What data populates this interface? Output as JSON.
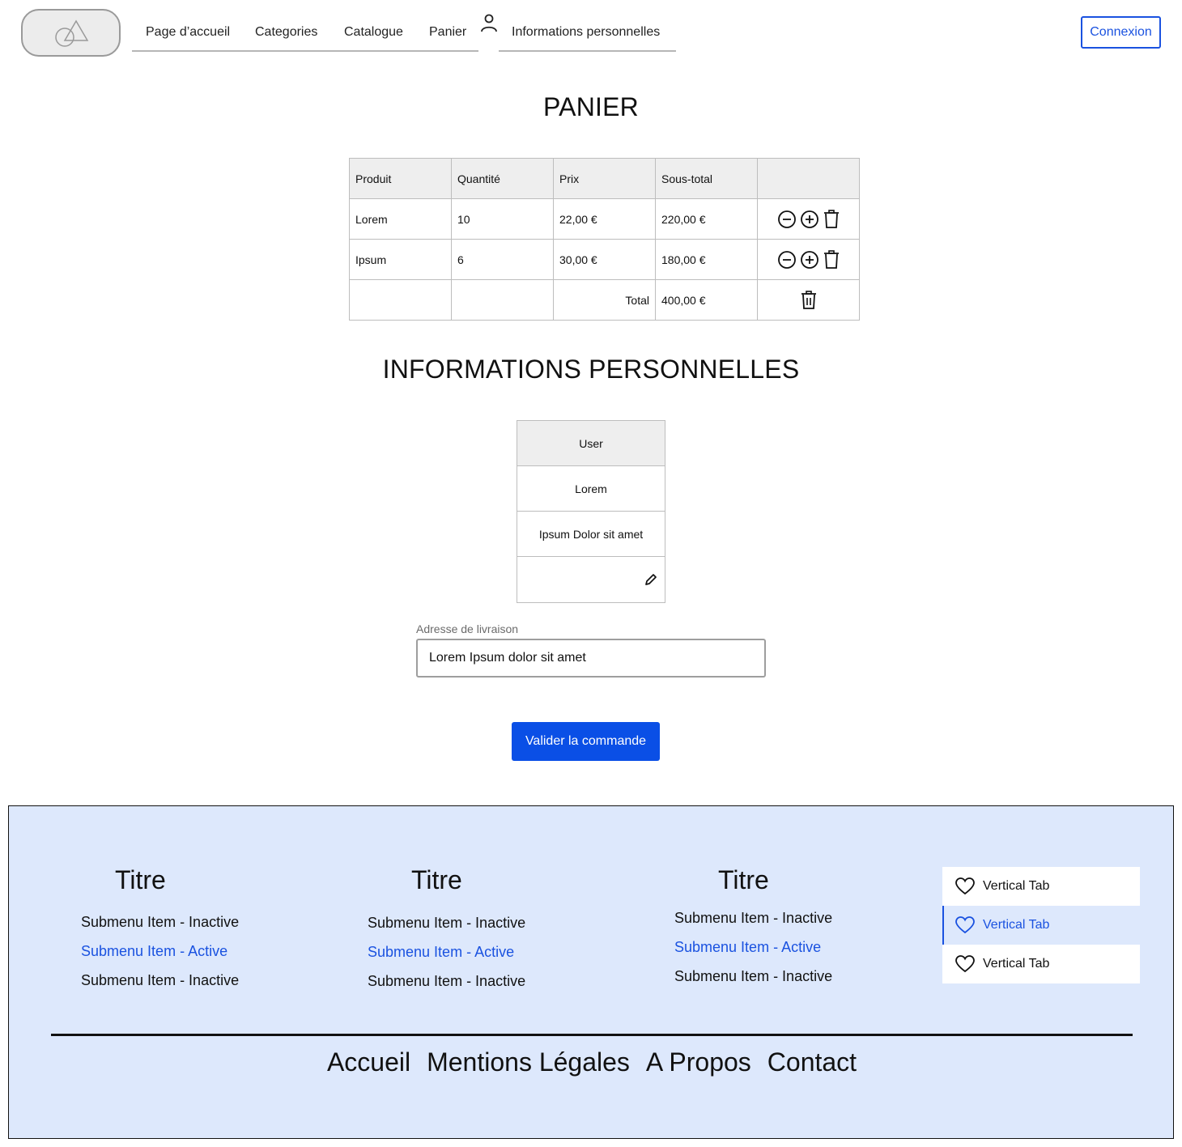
{
  "header": {
    "logo_icon": "shapes-logo-icon",
    "nav": [
      "Page d’accueil",
      "Categories",
      "Catalogue",
      "Panier"
    ],
    "user_icon": "user-icon",
    "personal_info": "Informations personnelles",
    "login_button": "Connexion"
  },
  "cart": {
    "title": "PANIER",
    "columns": [
      "Produit",
      "Quantité",
      "Prix",
      "Sous-total",
      ""
    ],
    "rows": [
      {
        "product": "Lorem",
        "quantity": "10",
        "price": "22,00 €",
        "subtotal": "220,00 €"
      },
      {
        "product": "Ipsum",
        "quantity": "6",
        "price": "30,00 €",
        "subtotal": "180,00 €"
      }
    ],
    "total_label": "Total",
    "total_value": "400,00 €",
    "icons": [
      "minus-circle-icon",
      "plus-circle-icon",
      "trash-icon"
    ]
  },
  "personal": {
    "title": "INFORMATIONS PERSONNELLES",
    "header": "User",
    "name": "Lorem",
    "details": "Ipsum Dolor sit amet",
    "edit_icon": "pencil-icon",
    "address_label": "Adresse de livraison",
    "address_value": "Lorem Ipsum dolor sit amet",
    "validate_button": "Valider la commande"
  },
  "footer": {
    "columns": [
      {
        "title": "Titre",
        "items": [
          "Submenu Item - Inactive",
          "Submenu Item - Active",
          "Submenu Item - Inactive"
        ]
      },
      {
        "title": "Titre",
        "items": [
          "Submenu Item - Inactive",
          "Submenu Item - Active",
          "Submenu Item - Inactive"
        ]
      },
      {
        "title": "Titre",
        "items": [
          "Submenu Item - Inactive",
          "Submenu Item - Active",
          "Submenu Item - Inactive"
        ]
      }
    ],
    "vertical_tabs": [
      "Vertical Tab",
      "Vertical Tab",
      "Vertical Tab"
    ],
    "vertical_tab_active_index": 1,
    "links": [
      "Accueil",
      "Mentions Légales",
      "A Propos",
      "Contact"
    ]
  },
  "colors": {
    "accent": "#1a52e0",
    "footer_bg": "#dde8fc",
    "table_header_bg": "#eeeeee"
  }
}
